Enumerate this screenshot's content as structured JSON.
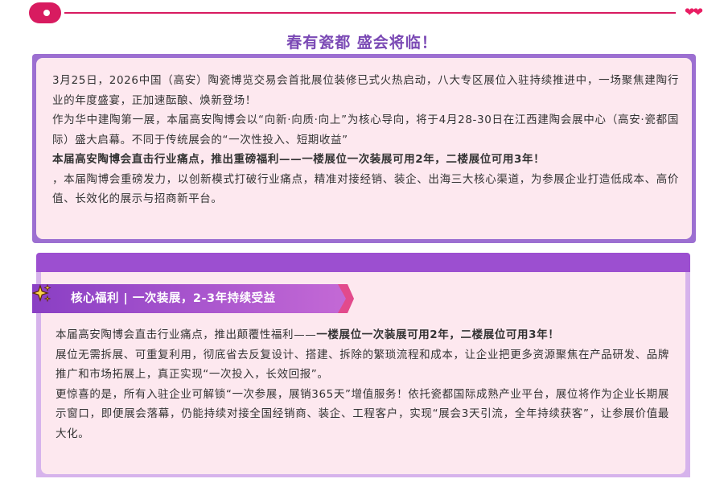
{
  "headline": "春有瓷都 盛会将临！",
  "section1": {
    "p1": "3月25日，2026中国（高安）陶瓷博览交易会首批展位装修已式火热启动，八大专区展位入驻持续推进中，一场聚焦建陶行业的年度盛宴，正加速酝酿、焕新登场！",
    "p2": "作为华中建陶第一展，本届高安陶博会以“向新·向质·向上”为核心导向，将于4月28-30日在江西建陶会展中心（高安·瓷都国际）盛大启幕。不同于传统展会的“一次性投入、短期收益”",
    "p3_bold": "本届高安陶博会直击行业痛点，推出重磅福利——一楼展位一次装展可用2年，二楼展位可用3年！",
    "p4": "，本届陶博会重磅发力，以创新模式打破行业痛点，精准对接经销、装企、出海三大核心渠道，为参展企业打造低成本、高价值、长效化的展示与招商新平台。"
  },
  "section2": {
    "ribbon_title": "核心福利 | 一次装展，2-3年持续受益",
    "p1_normal": "本届高安陶博会直击行业痛点，推出颠覆性福利——",
    "p1_bold": "一楼展位一次装展可用2年，二楼展位可用3年！",
    "p2": "展位无需拆展、可重复利用，彻底省去反复设计、搭建、拆除的繁琐流程和成本，让企业把更多资源聚焦在产品研发、品牌推广和市场拓展上，真正实现“一次投入，长效回报”。",
    "p3": "更惊喜的是，所有入驻企业可解锁“一次参展，展销365天”增值服务！依托瓷都国际成熟产业平台，展位将作为企业长期展示窗口，即便展会落幕，仍能持续对接全国经销商、装企、工程客户，实现“展会3天引流，全年持续获客”，让参展价值最大化。"
  },
  "colors": {
    "accent_pink": "#d81b60",
    "purple": "#9c6fd1",
    "ribbon": "#a855c9",
    "panel_bg": "#fde8ef"
  },
  "icons": {
    "top": "circle-dot-icon",
    "hearts": "hearts-icon",
    "ribbon": "sparkle-star-icon"
  }
}
